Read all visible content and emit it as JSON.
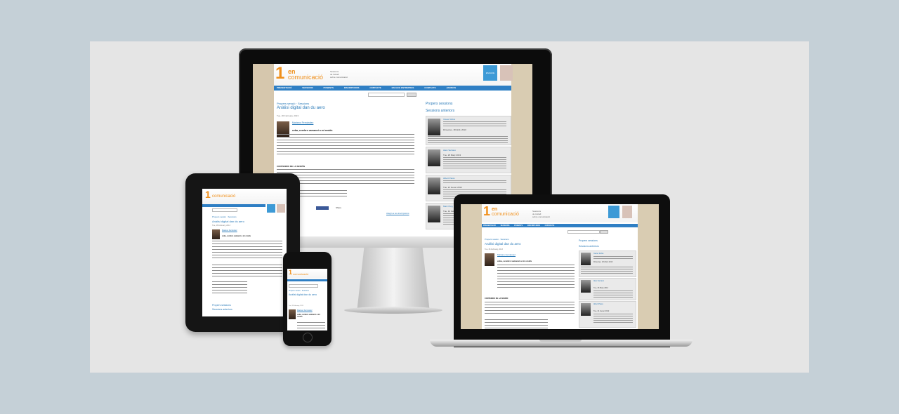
{
  "site": {
    "logo_number": "1",
    "logo_en": "en",
    "logo_word": "comunicació",
    "tagline_1": "Sessions",
    "tagline_2": "de treball",
    "tagline_3": "sobre comunicació",
    "badge": "ESCACE",
    "nav": [
      "PRESENTACIÓ",
      "SESSIONS",
      "PONENTS",
      "INSCRIPCIONS",
      "CONTACTE",
      "ESCACE ENTREPRES",
      "CONTACTE",
      "ANUNCIS"
    ],
    "breadcrumb": "Propers sessió · Sessions",
    "post_title": "Anàlisi digital dan du aero",
    "post_date": "Tue, 26 February, 2013",
    "author": "Mariano Fernández",
    "lead": "ceba, cerebro vamanci a mi oroids",
    "section": "CONTENIDO DE LA SESIÓN",
    "share": "Share",
    "more": "Afegir-te les inscripcions",
    "sidebar_title_1": "Propers sessions",
    "sidebar_title_2": "Sessions anteriors",
    "sessions": [
      {
        "name": "Xavier Rubio",
        "date": "Dimecres, 18 Abril, 2013"
      },
      {
        "name": "Aleix Serrano",
        "date": "Tue, 26 Març 2013"
      },
      {
        "name": "Albert Parés",
        "date": "Tue, 21 Gener 2012"
      },
      {
        "name": "Marc Puig",
        "date": "Tue, 14 Febrer 2012"
      }
    ]
  }
}
